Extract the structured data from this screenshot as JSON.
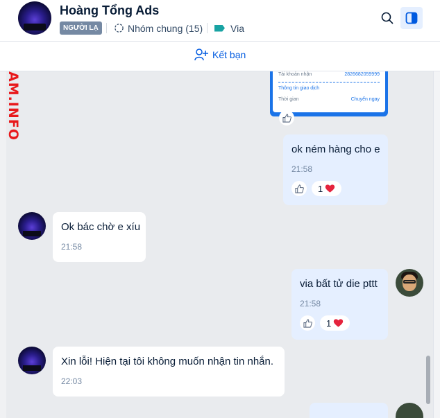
{
  "header": {
    "contact_name": "Hoàng Tổng Ads",
    "stranger_tag": "NGƯỜI LẠ",
    "groups_label": "Nhóm chung (15)",
    "label_tag": "Via",
    "label_color": "#18a3a3"
  },
  "friend_bar": {
    "add_friend_label": "Kết bạn"
  },
  "watermark": "AM.INFO",
  "transfer_image": {
    "account_label": "Tài khoản nhận",
    "account_value": "2826682059999",
    "section_label": "Thông tin giao dịch",
    "time_label": "Thời gian",
    "time_value": "Chuyển ngay"
  },
  "messages": [
    {
      "sender": "me",
      "text": "ok ném hàng cho e",
      "time": "21:58",
      "heart_count": "1"
    },
    {
      "sender": "them",
      "text": "Ok bác chờ e xíu",
      "time": "21:58"
    },
    {
      "sender": "me",
      "text": "via bất tử die pttt",
      "time": "21:58",
      "heart_count": "1"
    },
    {
      "sender": "them",
      "text": "Xin lỗi! Hiện tại tôi không muốn nhận tin nhắn.",
      "time": "22:03"
    }
  ],
  "colors": {
    "accent": "#005ae0",
    "my_bubble": "#e5efff",
    "heart": "#e5233d"
  },
  "icons": [
    "search-icon",
    "panel-toggle-icon",
    "add-user-icon",
    "group-icon",
    "tag-icon",
    "like-icon",
    "heart-icon"
  ]
}
